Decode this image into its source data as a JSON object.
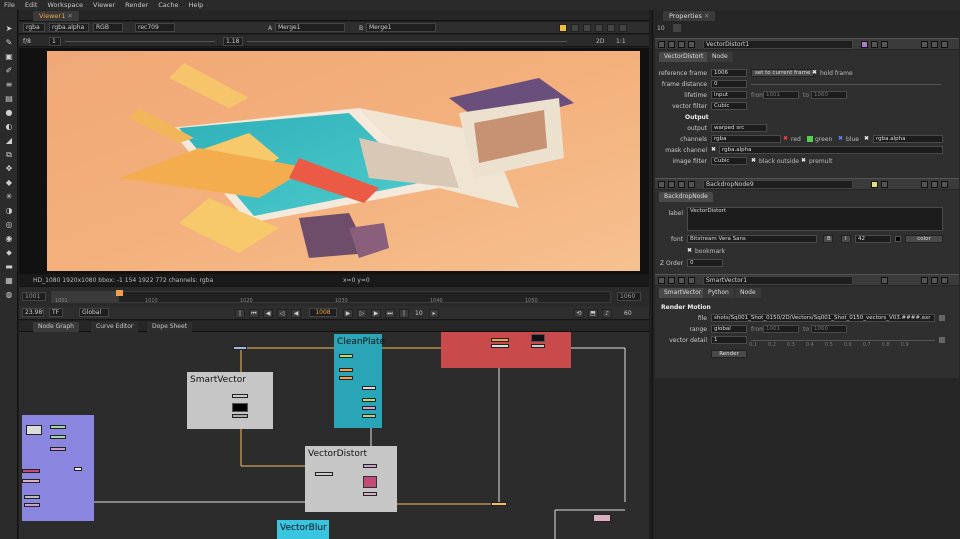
{
  "menu": [
    "File",
    "Edit",
    "Workspace",
    "Viewer",
    "Render",
    "Cache",
    "Help"
  ],
  "viewer": {
    "tab": "Viewer1",
    "channels": "rgba",
    "alpha": "rgba.alpha",
    "colorspace": "RGB",
    "lut": "rec709",
    "inputA_label": "A",
    "inputA": "Merge1",
    "inputB_label": "B",
    "inputB": "Merge1",
    "frame_prefix": "f/8",
    "gain": "1",
    "gamma": "1.18",
    "view_mode": "2D",
    "zoom": "1:1",
    "info": "HD_1080 1920x1080  bbox: -1 154 1922 772 channels: rgba",
    "coords": "x=0 y=0"
  },
  "timeline": {
    "start": "1001",
    "end": "1060",
    "ticks": [
      "1001",
      "1010",
      "1020",
      "1030",
      "1040",
      "1050"
    ],
    "fps": "23.98*",
    "tf": "TF",
    "scope": "Global",
    "current": "1008",
    "step": "10",
    "step2": "60",
    "progress": 0.12
  },
  "nodegraph": {
    "tabs": [
      "Node Graph",
      "Curve Editor",
      "Dope Sheet"
    ],
    "backdrops": {
      "smartvector": "SmartVector",
      "cleanplate": "CleanPlate",
      "vectordistort": "VectorDistort",
      "vectorblur": "VectorBlur"
    }
  },
  "properties": {
    "title": "Properties",
    "count": "10",
    "vd": {
      "name": "VectorDistort1",
      "tabs": [
        "VectorDistort",
        "Node"
      ],
      "reference_frame_label": "reference frame",
      "reference_frame": "1006",
      "set_current": "set to current frame",
      "hold_frame": "hold frame",
      "frame_distance_label": "frame distance",
      "frame_distance": "0",
      "lifetime_label": "lifetime",
      "lifetime": "input",
      "from_label": "from",
      "from": "1001",
      "to_label": "to",
      "to": "1060",
      "vector_filter_label": "vector filter",
      "vector_filter": "Cubic",
      "output_section": "Output",
      "output_label": "output",
      "output": "warped src",
      "channels_label": "channels",
      "channels": "rgba",
      "red": "red",
      "green": "green",
      "blue": "blue",
      "alpha": "rgba.alpha",
      "mask_label": "mask channel",
      "mask": "rgba.alpha",
      "image_filter_label": "image filter",
      "image_filter": "Cubic",
      "black_outside": "black outside",
      "premult": "premult"
    },
    "bd": {
      "name": "BackdropNode9",
      "tab": "BackdropNode",
      "label_label": "label",
      "label": "VectorDistort",
      "font_label": "font",
      "font": "Bitstream Vera Sans",
      "font_size": "42",
      "color_btn": "color",
      "bookmark": "bookmark",
      "zorder_label": "Z Order",
      "zorder": "0"
    },
    "sv": {
      "name": "SmartVector1",
      "tabs": [
        "SmartVector",
        "Python",
        "Node"
      ],
      "section": "Render Motion",
      "file_label": "file",
      "file": "shots/Sq001_Shot_0150/2D/Vectors/Sq001_Shot_0150_vectors_V03.####.exr",
      "range_label": "range",
      "range": "global",
      "from_label": "from",
      "from": "1001",
      "to_label": "to",
      "to": "1060",
      "vector_detail_label": "vector detail",
      "vector_detail": "1",
      "slider_ticks": [
        "0.1",
        "0.2",
        "0.3",
        "0.4",
        "0.5",
        "0.6",
        "0.7",
        "0.8",
        "0.9"
      ],
      "render_btn": "Render"
    }
  },
  "colors": {
    "accent": "#f0a24a",
    "smartvector_bd": "#c6c6c6",
    "cleanplate_bd": "#2aa5b8",
    "vectordistort_bd": "#c6c6c6",
    "vectorblur_bd": "#39c4e0",
    "red_bd": "#c94a4a",
    "purple_bd": "#8a86e0"
  }
}
